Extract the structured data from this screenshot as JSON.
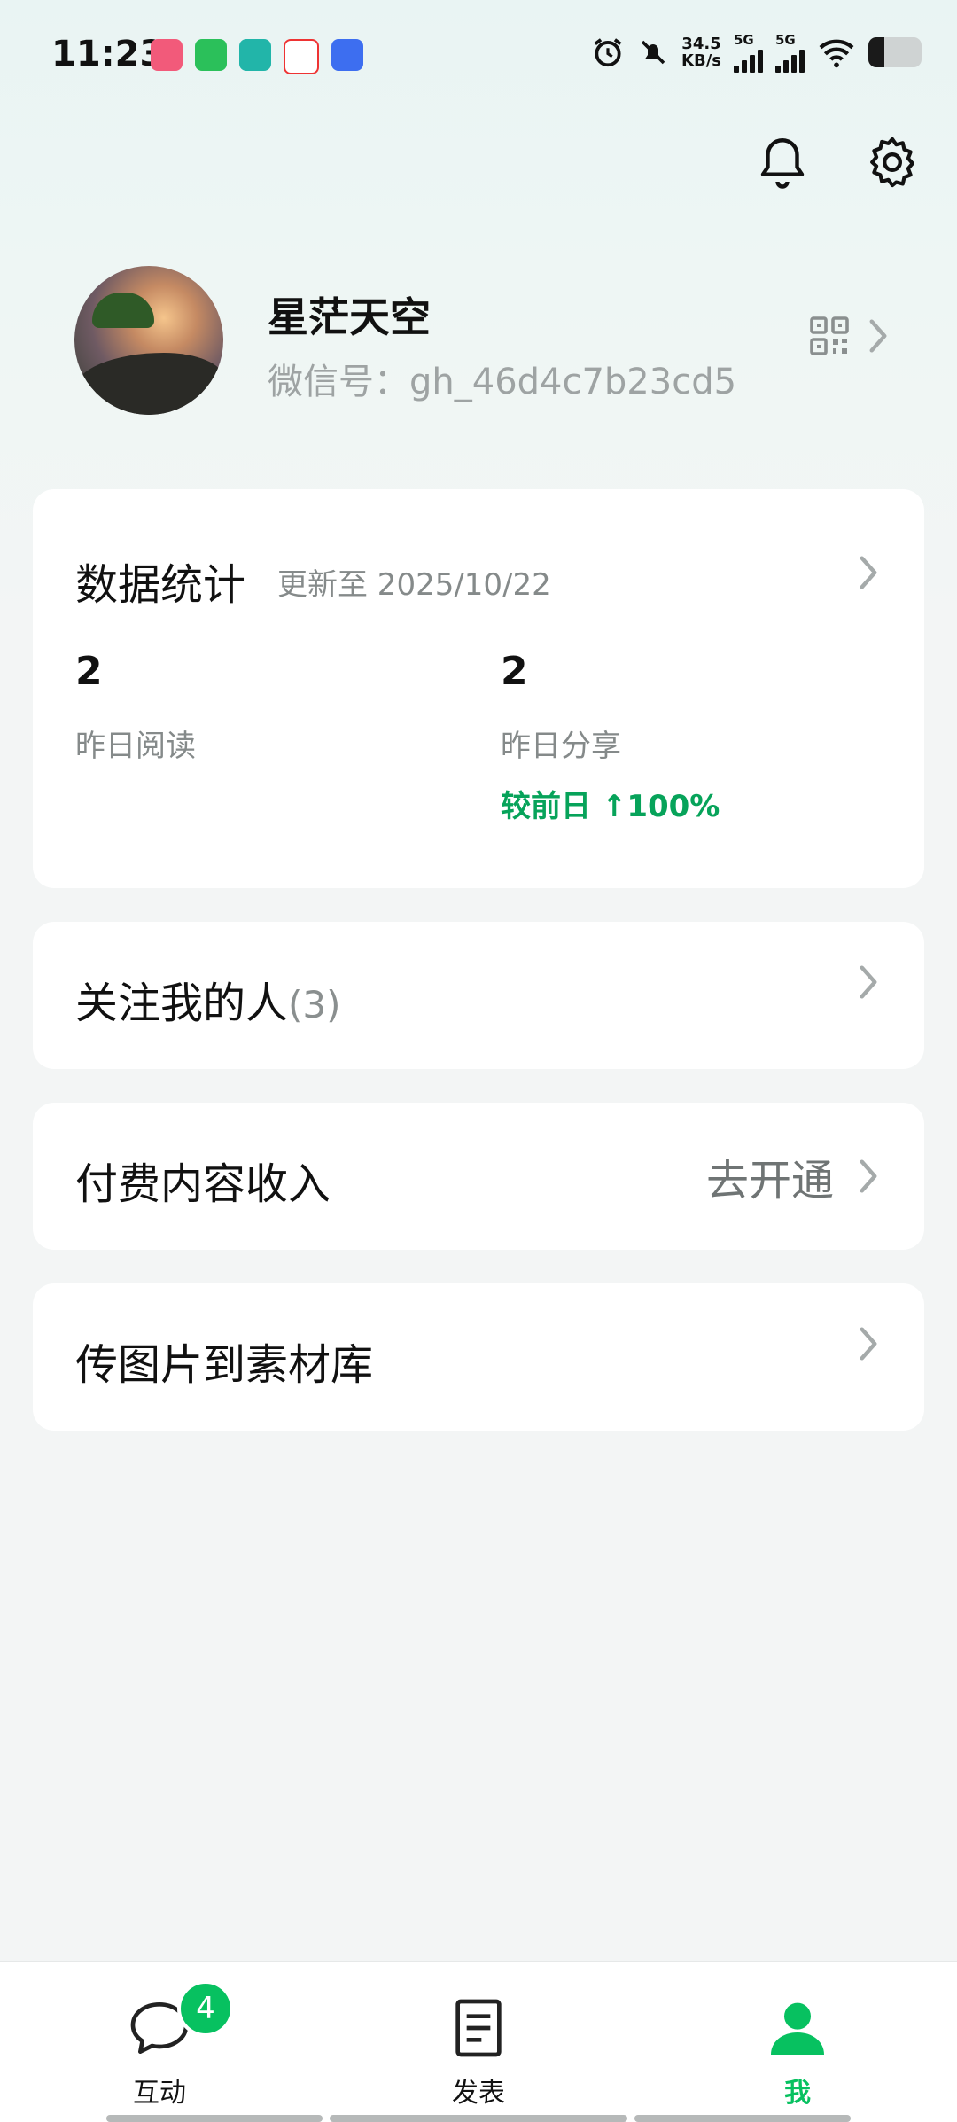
{
  "status_bar": {
    "time": "11:23",
    "net_speed_value": "34.5",
    "net_speed_unit": "KB/s",
    "signal_1": "5G",
    "signal_2": "5G",
    "battery_level": 0.3
  },
  "header": {
    "icons": [
      "bell-icon",
      "gear-icon"
    ]
  },
  "profile": {
    "name": "星茫天空",
    "wechat_id": "微信号：gh_46d4c7b23cd5"
  },
  "stats": {
    "title": "数据统计",
    "updated": "更新至 2025/10/22",
    "read_value": "2",
    "read_label": "昨日阅读",
    "share_value": "2",
    "share_label": "昨日分享",
    "share_delta": "较前日 ↑100%"
  },
  "menu": {
    "followers_label": "关注我的人",
    "followers_count": "(3)",
    "paid_label": "付费内容收入",
    "paid_action": "去开通",
    "upload_label": "传图片到素材库"
  },
  "tabbar": {
    "tabs": [
      {
        "label": "互动",
        "badge": "4"
      },
      {
        "label": "发表"
      },
      {
        "label": "我"
      }
    ]
  },
  "colors": {
    "accent": "#07c160",
    "delta_green": "#07a35a"
  }
}
